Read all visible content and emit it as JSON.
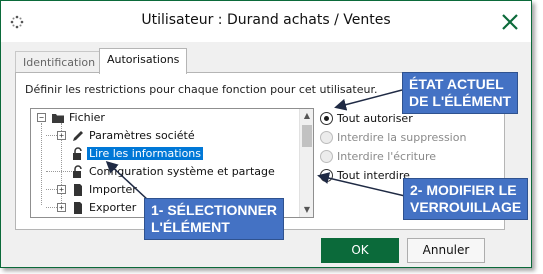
{
  "window": {
    "title": "Utilisateur : Durand achats / Ventes"
  },
  "tabs": [
    {
      "label": "Identification",
      "active": false
    },
    {
      "label": "Autorisations",
      "active": true
    }
  ],
  "panel": {
    "description": "Définir les restrictions pour chaque fonction pour cet utilisateur."
  },
  "tree": {
    "items": [
      {
        "label": "Fichier",
        "expander": "−",
        "icon": "folder-icon",
        "selected": false
      },
      {
        "label": "Paramètres société",
        "expander": "+",
        "icon": "pencil-icon",
        "selected": false
      },
      {
        "label": "Lire les informations",
        "expander": "",
        "icon": "unlocked-padlock-icon",
        "selected": true
      },
      {
        "label": "Configuration système et partage",
        "expander": "",
        "icon": "unlocked-padlock-icon",
        "selected": false
      },
      {
        "label": "Importer",
        "expander": "+",
        "icon": "document-icon",
        "selected": false
      },
      {
        "label": "Exporter",
        "expander": "+",
        "icon": "document-icon",
        "selected": false
      }
    ]
  },
  "permissions": [
    {
      "label": "Tout autoriser",
      "checked": true,
      "enabled": true
    },
    {
      "label": "Interdire la suppression",
      "checked": false,
      "enabled": false
    },
    {
      "label": "Interdire l'écriture",
      "checked": false,
      "enabled": false
    },
    {
      "label": "Tout interdire",
      "checked": false,
      "enabled": true
    }
  ],
  "buttons": {
    "ok": "OK",
    "cancel": "Annuler"
  },
  "callouts": {
    "current_state": {
      "line1": "ÉTAT ACTUEL",
      "line2": "DE L'ÉLÉMENT"
    },
    "modify_lock": {
      "line1": "2- MODIFIER LE",
      "line2": "VERROUILLAGE"
    },
    "select_item": {
      "line1": "1- SÉLECTIONNER",
      "line2": "L'ÉLÉMENT"
    }
  },
  "colors": {
    "accent_green": "#0b6a3a",
    "selection_blue": "#0078d7",
    "callout_blue": "#4472c4"
  }
}
